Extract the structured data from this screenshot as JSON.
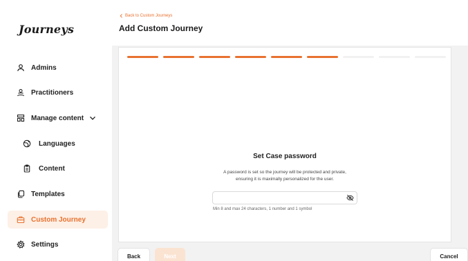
{
  "app": {
    "logo": "Journeys"
  },
  "sidebar": {
    "items": [
      {
        "label": "Admins",
        "icon": "user-icon"
      },
      {
        "label": "Practitioners",
        "icon": "users-icon"
      },
      {
        "label": "Manage content",
        "icon": "layout-icon",
        "expandable": true
      },
      {
        "label": "Languages",
        "icon": "globe-icon"
      },
      {
        "label": "Content",
        "icon": "clipboard-icon"
      },
      {
        "label": "Templates",
        "icon": "copy-icon"
      },
      {
        "label": "Custom Journey",
        "icon": "briefcase-icon",
        "active": true
      },
      {
        "label": "Settings",
        "icon": "gear-icon"
      }
    ]
  },
  "header": {
    "back_label": "Back to Custom Journeys",
    "title": "Add Custom Journey"
  },
  "progress": {
    "total_steps": 9,
    "completed_steps": 6
  },
  "form": {
    "title": "Set Case password",
    "description_line1": "A password is set so the journey will be protected and private,",
    "description_line2": "ensuring it is maximally personalized for the user.",
    "password_value": "",
    "password_placeholder": "",
    "hint": "Min 8 and max 24 characters, 1 number and 1 symbol"
  },
  "footer": {
    "back_label": "Back",
    "next_label": "Next",
    "cancel_label": "Cancel"
  },
  "colors": {
    "accent": "#e8712f",
    "active_bg": "#fdf0e6",
    "disabled_button": "#fbe3d2"
  }
}
